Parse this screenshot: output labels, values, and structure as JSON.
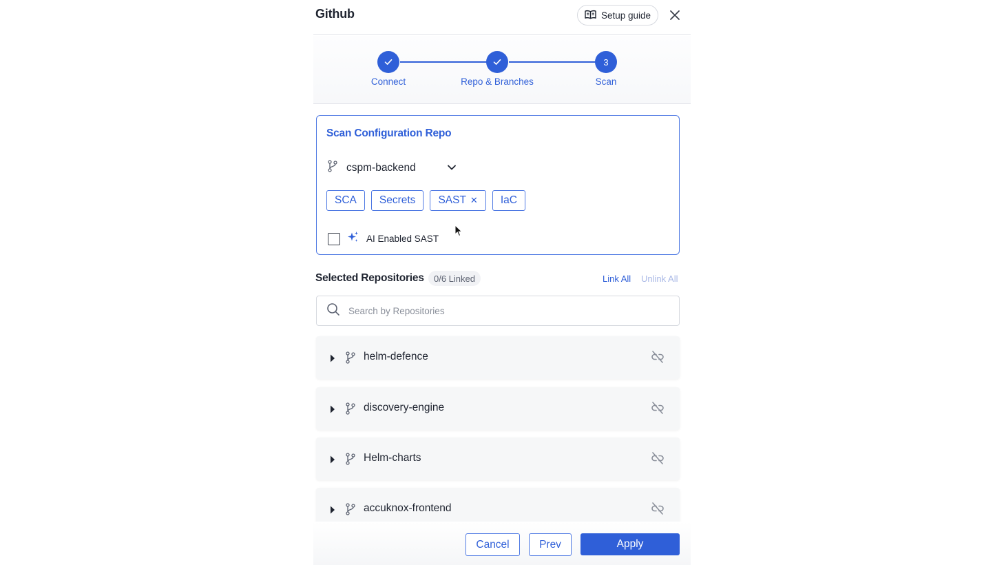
{
  "header": {
    "title": "Github",
    "setup_guide_label": "Setup guide"
  },
  "stepper": {
    "steps": [
      {
        "label": "Connect",
        "state": "done",
        "number": ""
      },
      {
        "label": "Repo & Branches",
        "state": "done",
        "number": ""
      },
      {
        "label": "Scan",
        "state": "active",
        "number": "3"
      }
    ]
  },
  "scan_config": {
    "title": "Scan Configuration Repo",
    "selected_repo": "cspm-backend",
    "chips": [
      {
        "label": "SCA",
        "removable": false
      },
      {
        "label": "Secrets",
        "removable": false
      },
      {
        "label": "SAST",
        "removable": true
      },
      {
        "label": "IaC",
        "removable": false
      }
    ],
    "ai_label": "AI Enabled SAST",
    "ai_checked": false
  },
  "selected_repos": {
    "title": "Selected Repositories",
    "linked_badge": "0/6 Linked",
    "link_all": "Link All",
    "unlink_all": "Unlink All",
    "search_placeholder": "Search by Repositories",
    "items": [
      {
        "name": "helm-defence"
      },
      {
        "name": "discovery-engine"
      },
      {
        "name": "Helm-charts"
      },
      {
        "name": "accuknox-frontend"
      }
    ]
  },
  "footer": {
    "cancel": "Cancel",
    "prev": "Prev",
    "apply": "Apply"
  },
  "colors": {
    "accent": "#2f5fd8",
    "text": "#1f2430",
    "muted": "#8a8f9a",
    "row_bg": "#f6f7f8"
  }
}
